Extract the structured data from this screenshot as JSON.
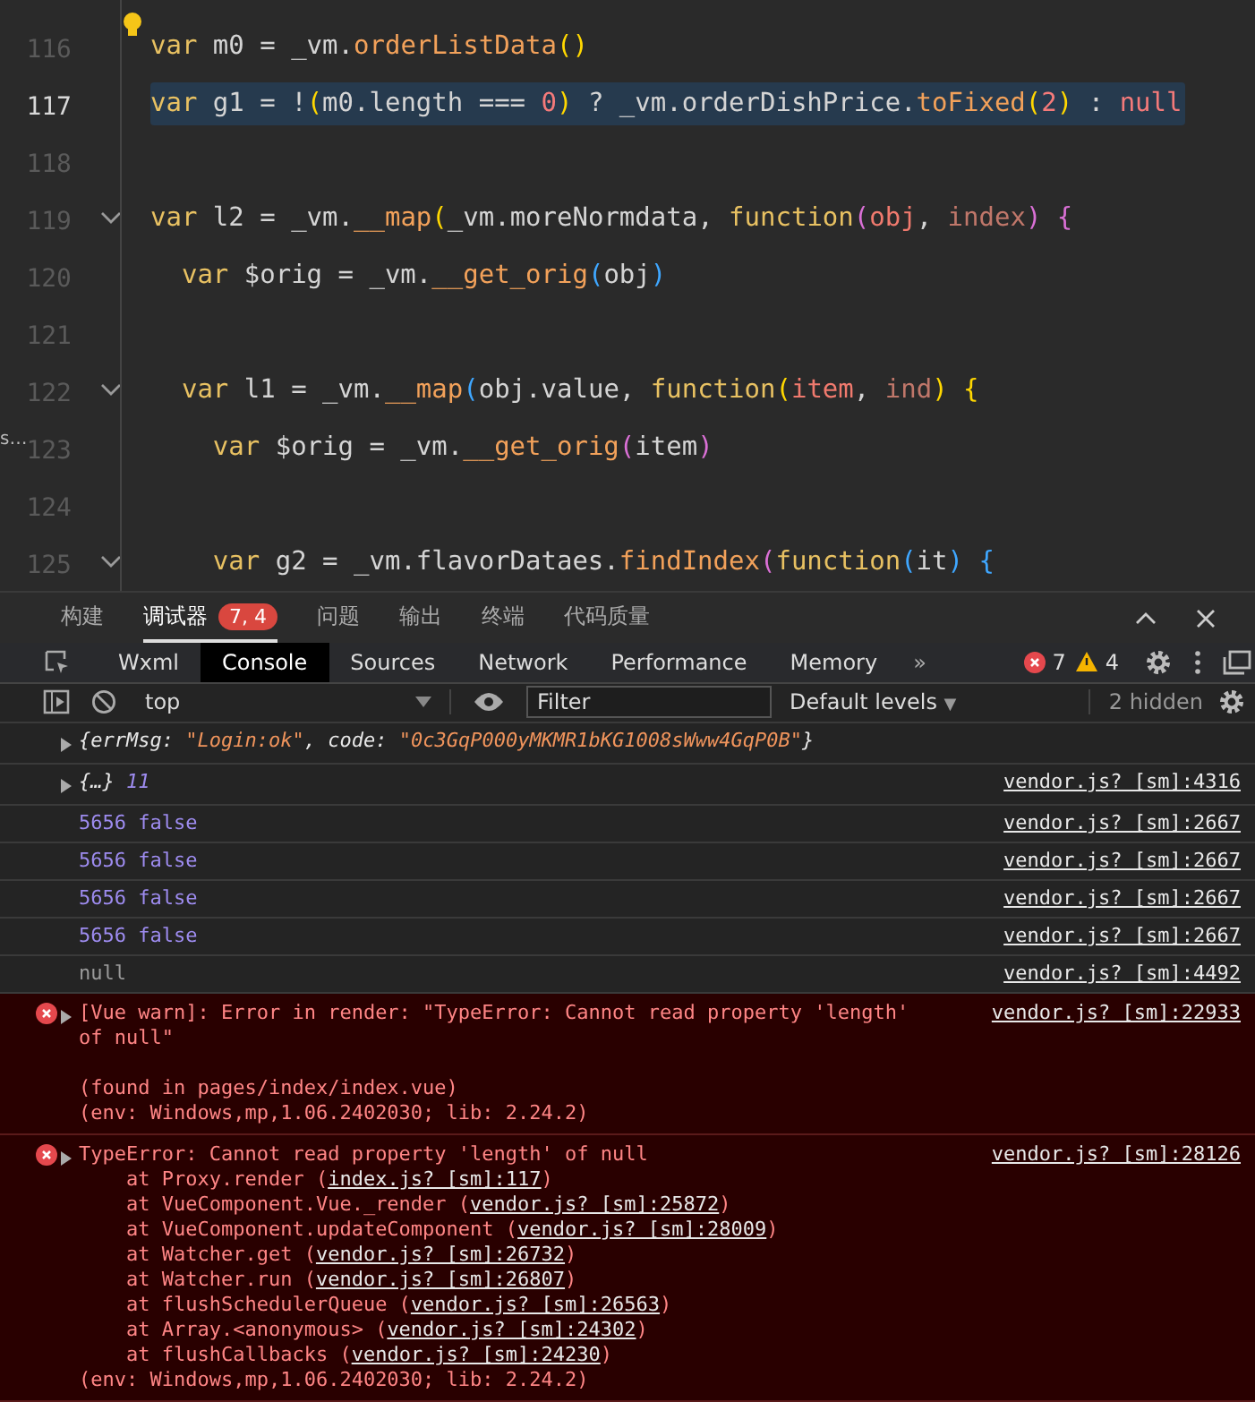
{
  "editor": {
    "gutter_fragment": "s…",
    "lines": [
      {
        "number": "116",
        "current": false,
        "hint": true,
        "foldable": false,
        "tokens": [
          {
            "text": "var",
            "kind": "kw"
          },
          {
            "text": " m0 = _vm.",
            "kind": "plain"
          },
          {
            "text": "orderListData",
            "kind": "fn"
          },
          {
            "text": "()",
            "kind": "b1"
          }
        ]
      },
      {
        "number": "117",
        "current": true,
        "hint": false,
        "foldable": false,
        "tokens": [
          {
            "text": "var",
            "kind": "kw"
          },
          {
            "text": " g1 = !",
            "kind": "plain"
          },
          {
            "text": "(",
            "kind": "b1"
          },
          {
            "text": "m0.length === ",
            "kind": "plain"
          },
          {
            "text": "0",
            "kind": "num"
          },
          {
            "text": ")",
            "kind": "b1"
          },
          {
            "text": " ? _vm.orderDishPrice.",
            "kind": "plain"
          },
          {
            "text": "toFixed",
            "kind": "fn"
          },
          {
            "text": "(",
            "kind": "b1"
          },
          {
            "text": "2",
            "kind": "num"
          },
          {
            "text": ")",
            "kind": "b1"
          },
          {
            "text": " : ",
            "kind": "plain"
          },
          {
            "text": "null",
            "kind": "num"
          }
        ]
      },
      {
        "number": "118",
        "current": false,
        "hint": false,
        "foldable": false
      },
      {
        "number": "119",
        "current": false,
        "hint": false,
        "foldable": true,
        "tokens": [
          {
            "text": "var",
            "kind": "kw"
          },
          {
            "text": " l2 = _vm.",
            "kind": "plain"
          },
          {
            "text": "__map",
            "kind": "fn"
          },
          {
            "text": "(",
            "kind": "b1"
          },
          {
            "text": "_vm.moreNormdata, ",
            "kind": "plain"
          },
          {
            "text": "function",
            "kind": "kw"
          },
          {
            "text": "(",
            "kind": "b2"
          },
          {
            "text": "obj",
            "kind": "param"
          },
          {
            "text": ", ",
            "kind": "plain"
          },
          {
            "text": "index",
            "kind": "param2"
          },
          {
            "text": ") {",
            "kind": "b2"
          }
        ]
      },
      {
        "number": "120",
        "current": false,
        "hint": false,
        "foldable": false,
        "tokens": [
          {
            "text": "  var",
            "kind": "kw"
          },
          {
            "text": " $orig = _vm.",
            "kind": "plain"
          },
          {
            "text": "__get_orig",
            "kind": "fn"
          },
          {
            "text": "(",
            "kind": "b3"
          },
          {
            "text": "obj",
            "kind": "plain"
          },
          {
            "text": ")",
            "kind": "b3"
          }
        ]
      },
      {
        "number": "121",
        "current": false,
        "hint": false,
        "foldable": false
      },
      {
        "number": "122",
        "current": false,
        "hint": false,
        "foldable": true,
        "tokens": [
          {
            "text": "  var",
            "kind": "kw"
          },
          {
            "text": " l1 = _vm.",
            "kind": "plain"
          },
          {
            "text": "__map",
            "kind": "fn"
          },
          {
            "text": "(",
            "kind": "b3"
          },
          {
            "text": "obj.value, ",
            "kind": "plain"
          },
          {
            "text": "function",
            "kind": "kw"
          },
          {
            "text": "(",
            "kind": "b1"
          },
          {
            "text": "item",
            "kind": "param"
          },
          {
            "text": ", ",
            "kind": "plain"
          },
          {
            "text": "ind",
            "kind": "param2"
          },
          {
            "text": ") {",
            "kind": "b1"
          }
        ]
      },
      {
        "number": "123",
        "current": false,
        "hint": false,
        "foldable": false,
        "tokens": [
          {
            "text": "    var",
            "kind": "kw"
          },
          {
            "text": " $orig = _vm.",
            "kind": "plain"
          },
          {
            "text": "__get_orig",
            "kind": "fn"
          },
          {
            "text": "(",
            "kind": "b2"
          },
          {
            "text": "item",
            "kind": "plain"
          },
          {
            "text": ")",
            "kind": "b2"
          }
        ]
      },
      {
        "number": "124",
        "current": false,
        "hint": false,
        "foldable": false
      },
      {
        "number": "125",
        "current": false,
        "hint": false,
        "foldable": true,
        "tokens": [
          {
            "text": "    var",
            "kind": "kw"
          },
          {
            "text": " g2 = _vm.flavorDataes.",
            "kind": "plain"
          },
          {
            "text": "findIndex",
            "kind": "fn"
          },
          {
            "text": "(",
            "kind": "b2"
          },
          {
            "text": "function",
            "kind": "kw"
          },
          {
            "text": "(",
            "kind": "b3"
          },
          {
            "text": "it",
            "kind": "plain"
          },
          {
            "text": ") {",
            "kind": "b3"
          }
        ]
      }
    ]
  },
  "panel_tabs": [
    {
      "label": "构建",
      "selected": false
    },
    {
      "label": "调试器",
      "selected": true,
      "badge": "7, 4"
    },
    {
      "label": "问题",
      "selected": false
    },
    {
      "label": "输出",
      "selected": false
    },
    {
      "label": "终端",
      "selected": false
    },
    {
      "label": "代码质量",
      "selected": false
    }
  ],
  "devtools_tabs": [
    {
      "label": "Wxml",
      "selected": false
    },
    {
      "label": "Console",
      "selected": true
    },
    {
      "label": "Sources",
      "selected": false
    },
    {
      "label": "Network",
      "selected": false
    },
    {
      "label": "Performance",
      "selected": false
    },
    {
      "label": "Memory",
      "selected": false
    }
  ],
  "more_tabs": "»",
  "error_count": "7",
  "warning_count": "4",
  "toolbar": {
    "context": "top",
    "filter_placeholder": "Filter",
    "levels": "Default levels",
    "levels_caret": "▼",
    "hidden": "2 hidden"
  },
  "console": [
    {
      "kind": "log",
      "expandable": true,
      "lines": [
        [
          {
            "text": "{",
            "kind": "key"
          },
          {
            "text": "errMsg",
            "kind": "key"
          },
          {
            "text": ": ",
            "kind": "key"
          },
          {
            "text": "\"Login:ok\"",
            "kind": "str"
          },
          {
            "text": ", code: ",
            "kind": "key"
          },
          {
            "text": "\"0c3GqP000yMKMR1bKG1008sWww4GqP0B\"",
            "kind": "str"
          },
          {
            "text": "}",
            "kind": "key"
          }
        ]
      ]
    },
    {
      "kind": "log",
      "expandable": true,
      "source": "vendor.js? [sm]:4316",
      "lines": [
        [
          {
            "text": "{…}",
            "kind": "key"
          },
          {
            "text": " 11",
            "kind": "num"
          }
        ]
      ]
    },
    {
      "kind": "log",
      "expandable": false,
      "source": "vendor.js? [sm]:2667",
      "lines": [
        [
          {
            "text": "5656 false",
            "kind": "num"
          }
        ]
      ]
    },
    {
      "kind": "log",
      "expandable": false,
      "source": "vendor.js? [sm]:2667",
      "lines": [
        [
          {
            "text": "5656 false",
            "kind": "num"
          }
        ]
      ]
    },
    {
      "kind": "log",
      "expandable": false,
      "source": "vendor.js? [sm]:2667",
      "lines": [
        [
          {
            "text": "5656 false",
            "kind": "num"
          }
        ]
      ]
    },
    {
      "kind": "log",
      "expandable": false,
      "source": "vendor.js? [sm]:2667",
      "lines": [
        [
          {
            "text": "5656 false",
            "kind": "num"
          }
        ]
      ]
    },
    {
      "kind": "log",
      "expandable": false,
      "source": "vendor.js? [sm]:4492",
      "lines": [
        [
          {
            "text": "null",
            "kind": "null"
          }
        ]
      ]
    },
    {
      "kind": "error",
      "expandable": true,
      "source": "vendor.js? [sm]:22933",
      "lines": [
        [
          {
            "text": "[Vue warn]: Error in render: \"TypeError: Cannot read property 'length'",
            "kind": "plain"
          }
        ],
        [
          {
            "text": "of null\"",
            "kind": "plain"
          }
        ]
      ],
      "details": [
        [
          {
            "text": "(found in pages/index/index.vue)",
            "kind": "plain"
          }
        ],
        [
          {
            "text": "(env: Windows,mp,1.06.2402030; lib: 2.24.2)",
            "kind": "plain"
          }
        ]
      ]
    },
    {
      "kind": "error",
      "expandable": true,
      "source": "vendor.js? [sm]:28126",
      "lines": [
        [
          {
            "text": "TypeError: Cannot read property 'length' of null",
            "kind": "plain"
          }
        ],
        [
          {
            "text": "    at Proxy.render (",
            "kind": "plain"
          },
          {
            "text": "index.js? [sm]:117",
            "kind": "link"
          },
          {
            "text": ")",
            "kind": "plain"
          }
        ],
        [
          {
            "text": "    at VueComponent.Vue._render (",
            "kind": "plain"
          },
          {
            "text": "vendor.js? [sm]:25872",
            "kind": "link"
          },
          {
            "text": ")",
            "kind": "plain"
          }
        ],
        [
          {
            "text": "    at VueComponent.updateComponent (",
            "kind": "plain"
          },
          {
            "text": "vendor.js? [sm]:28009",
            "kind": "link"
          },
          {
            "text": ")",
            "kind": "plain"
          }
        ],
        [
          {
            "text": "    at Watcher.get (",
            "kind": "plain"
          },
          {
            "text": "vendor.js? [sm]:26732",
            "kind": "link"
          },
          {
            "text": ")",
            "kind": "plain"
          }
        ],
        [
          {
            "text": "    at Watcher.run (",
            "kind": "plain"
          },
          {
            "text": "vendor.js? [sm]:26807",
            "kind": "link"
          },
          {
            "text": ")",
            "kind": "plain"
          }
        ],
        [
          {
            "text": "    at flushSchedulerQueue (",
            "kind": "plain"
          },
          {
            "text": "vendor.js? [sm]:26563",
            "kind": "link"
          },
          {
            "text": ")",
            "kind": "plain"
          }
        ],
        [
          {
            "text": "    at Array.<anonymous> (",
            "kind": "plain"
          },
          {
            "text": "vendor.js? [sm]:24302",
            "kind": "link"
          },
          {
            "text": ")",
            "kind": "plain"
          }
        ],
        [
          {
            "text": "    at flushCallbacks (",
            "kind": "plain"
          },
          {
            "text": "vendor.js? [sm]:24230",
            "kind": "link"
          },
          {
            "text": ")",
            "kind": "plain"
          }
        ],
        [
          {
            "text": "(env: Windows,mp,1.06.2402030; lib: 2.24.2)",
            "kind": "plain"
          }
        ]
      ]
    }
  ]
}
